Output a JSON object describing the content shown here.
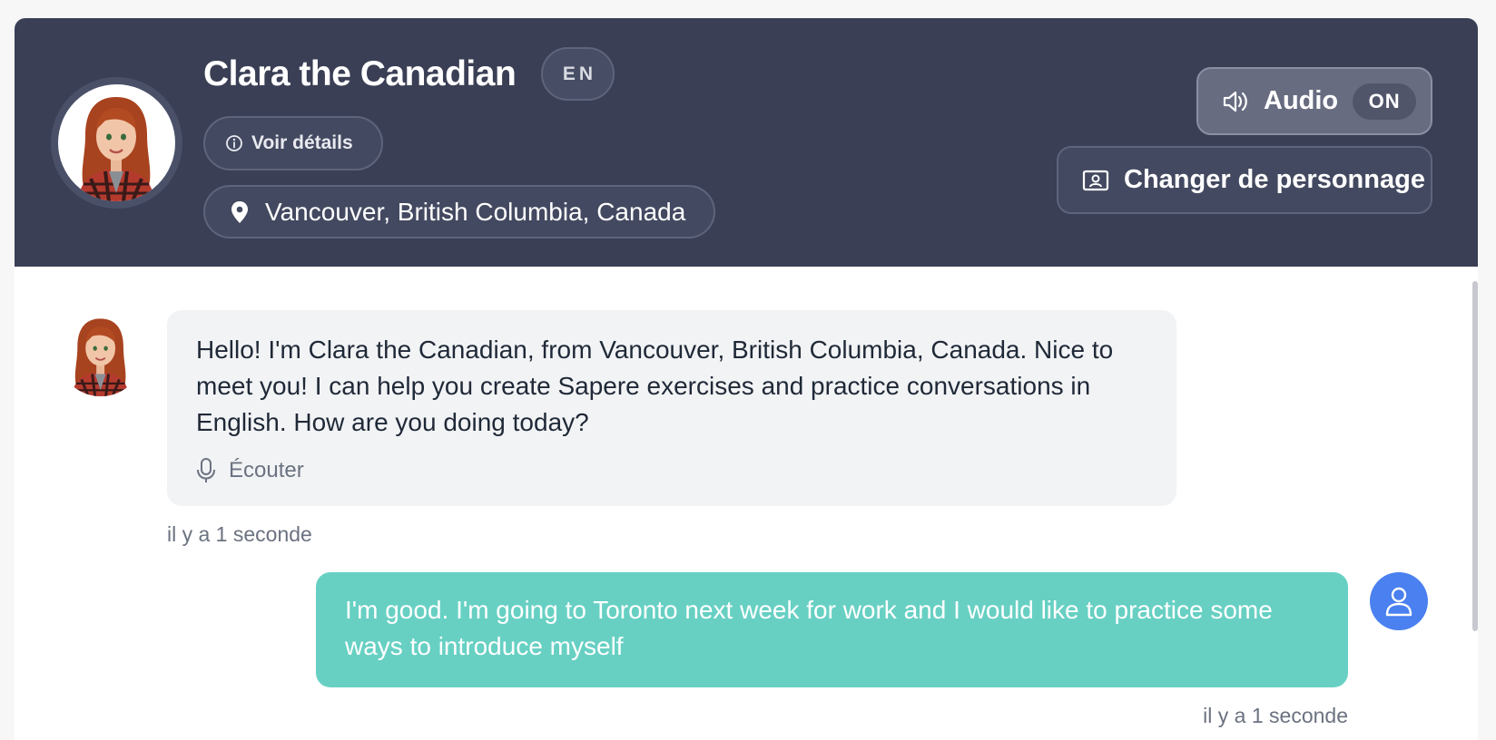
{
  "character": {
    "name": "Clara the Canadian",
    "language_badge": "EN",
    "details_button": "Voir détails",
    "location": "Vancouver, British Columbia, Canada"
  },
  "controls": {
    "audio_label": "Audio",
    "audio_state": "ON",
    "change_character": "Changer de personnage"
  },
  "messages": [
    {
      "sender": "bot",
      "text": "Hello! I'm Clara the Canadian, from Vancouver, British Columbia, Canada. Nice to meet you! I can help you create Sapere exercises and practice conversations in English. How are you doing today?",
      "listen_label": "Écouter",
      "time": "il y a 1 seconde"
    },
    {
      "sender": "user",
      "text": "I'm good. I'm going to Toronto next week for work and I would like to practice some ways to introduce myself",
      "time": "il y a 1 seconde"
    }
  ],
  "colors": {
    "header_bg": "#3a3f55",
    "user_bubble": "#67d0c3",
    "user_avatar": "#4a80ef",
    "bot_bubble": "#f2f3f5"
  }
}
